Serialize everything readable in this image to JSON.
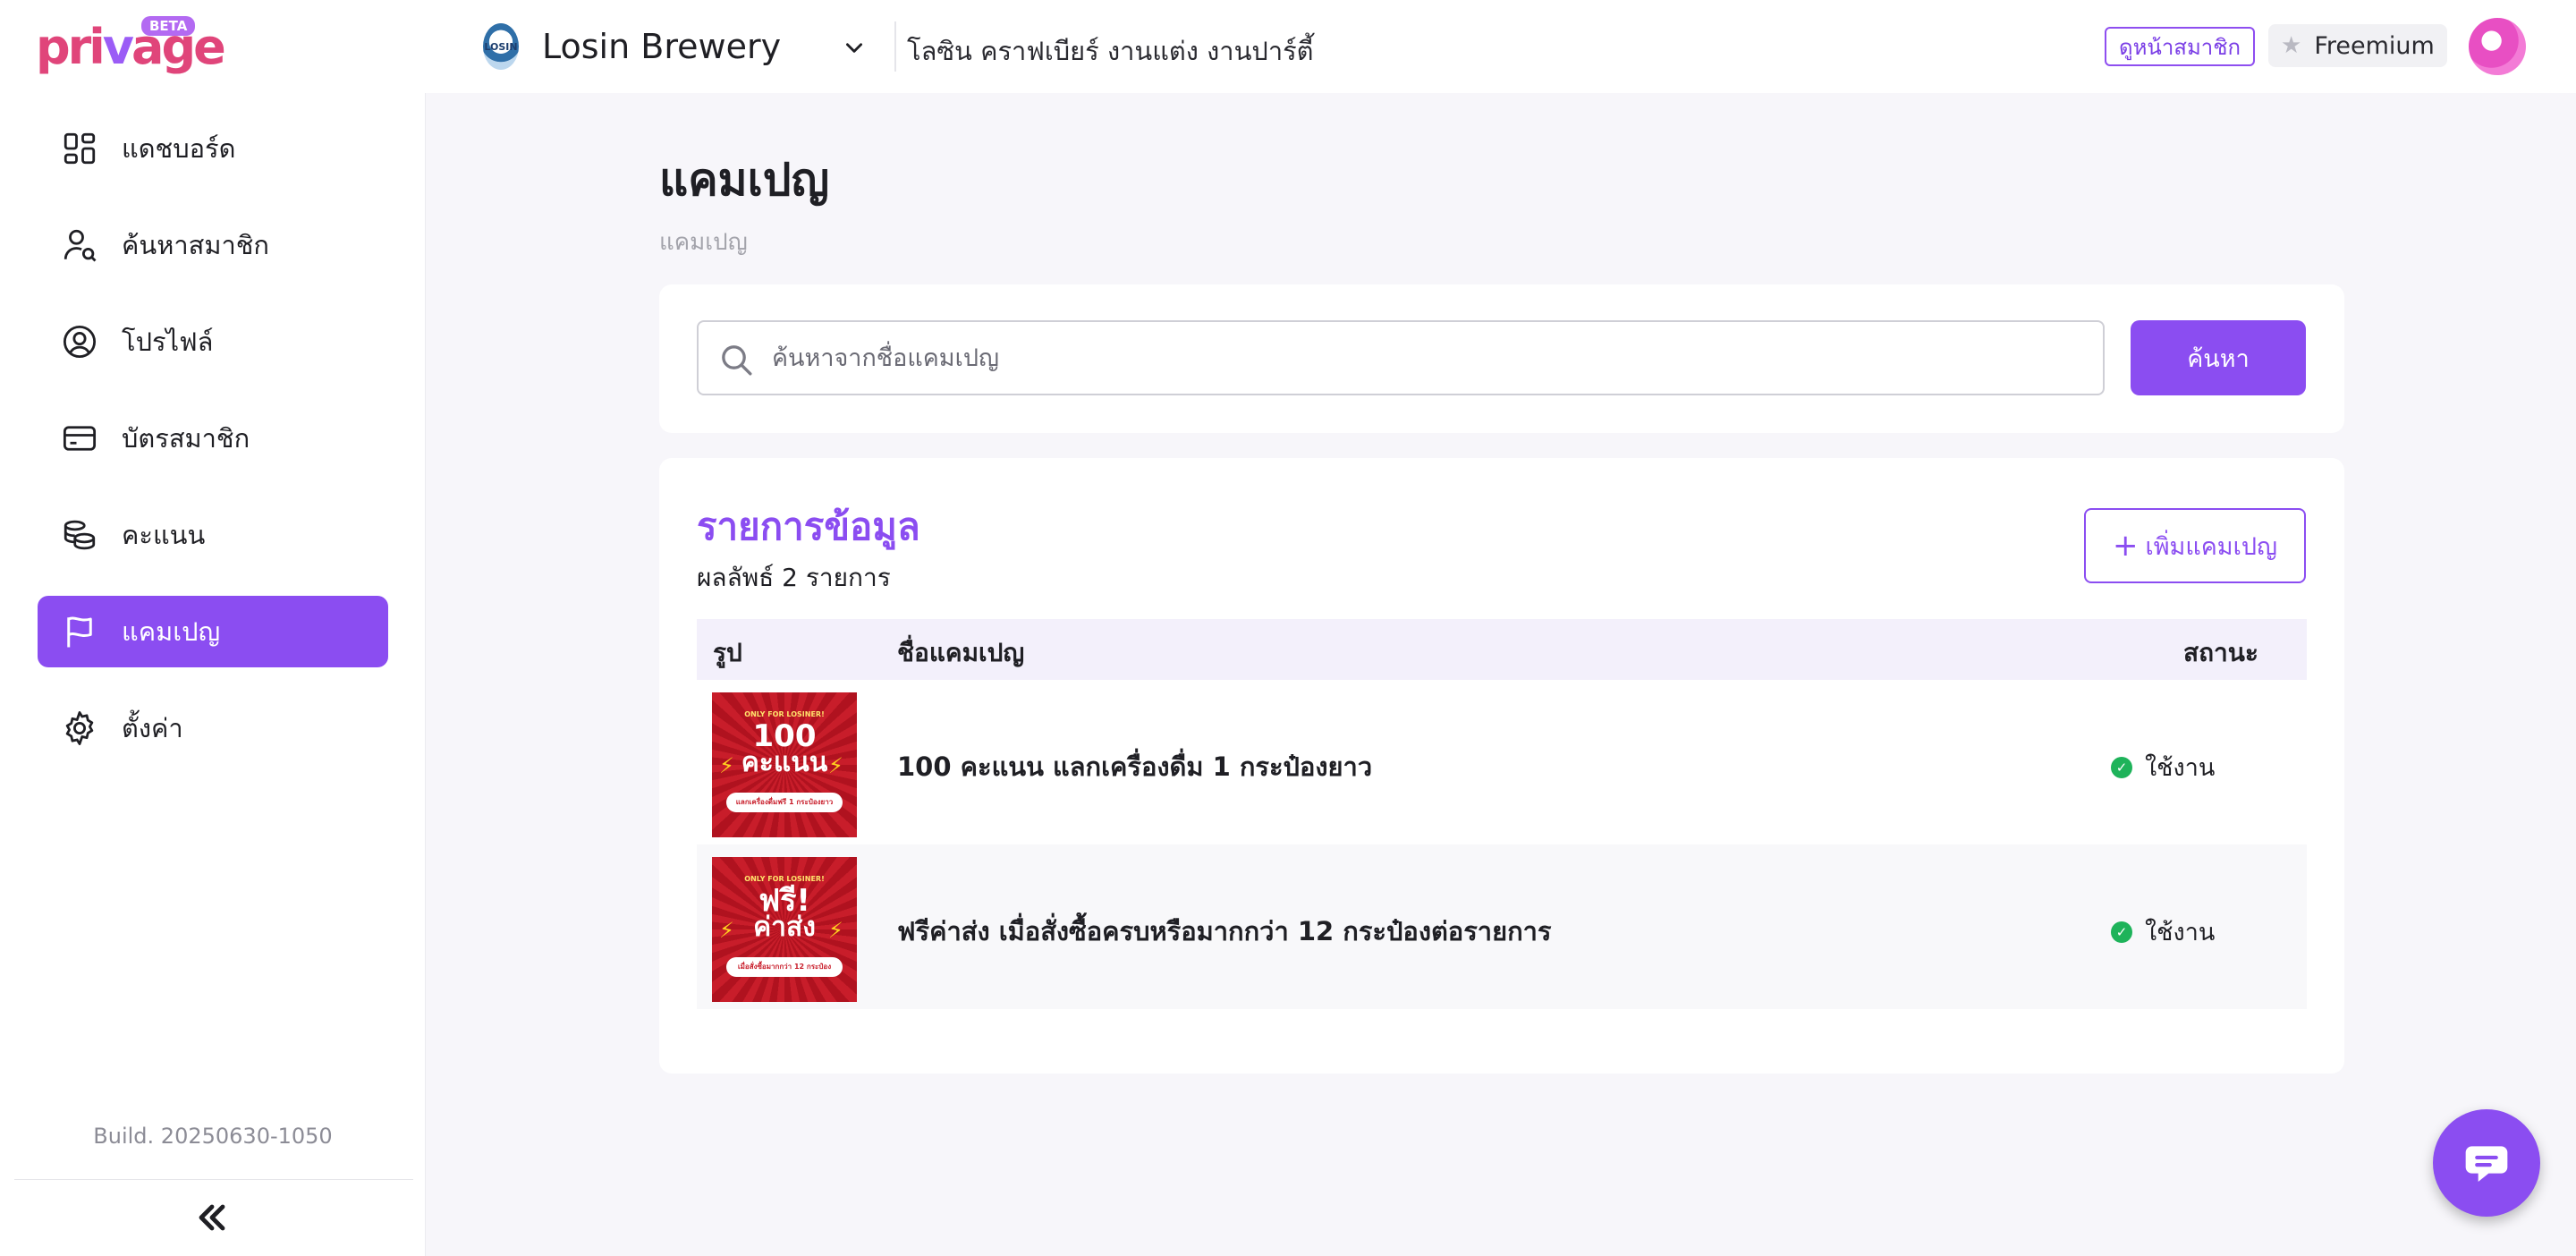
{
  "header": {
    "logo_text": "privage",
    "logo_badge": "BETA",
    "brand_logo_text": "LOSIN",
    "brand_name": "Losin Brewery",
    "brand_description": "โลซิน คราฟเบียร์ งานแต่ง งานปาร์ตี้",
    "member_page_link": "ดูหน้าสมาชิก",
    "plan_name": "Freemium"
  },
  "sidebar": {
    "items": [
      {
        "label": "แดชบอร์ด",
        "icon": "dashboard-icon",
        "active": false
      },
      {
        "label": "ค้นหาสมาชิก",
        "icon": "member-search-icon",
        "active": false
      },
      {
        "label": "โปรไฟล์",
        "icon": "profile-icon",
        "active": false
      },
      {
        "label": "บัตรสมาชิก",
        "icon": "member-card-icon",
        "active": false
      },
      {
        "label": "คะแนน",
        "icon": "points-coins-icon",
        "active": false
      },
      {
        "label": "แคมเปญ",
        "icon": "flag-icon",
        "active": true
      },
      {
        "label": "ตั้งค่า",
        "icon": "gear-icon",
        "active": false
      }
    ],
    "build": "Build. 20250630-1050",
    "collapse_icon": "double-chevron-left-icon"
  },
  "main": {
    "title": "แคมเปญ",
    "breadcrumb": "แคมเปญ",
    "search": {
      "placeholder": "ค้นหาจากชื่อแคมเปญ",
      "value": "",
      "button_label": "ค้นหา"
    },
    "list": {
      "title": "รายการข้อมูล",
      "result_count": "ผลลัพธ์ 2 รายการ",
      "add_button_label": "เพิ่มแคมเปญ",
      "columns": [
        "รูป",
        "ชื่อแคมเปญ",
        "สถานะ"
      ],
      "rows": [
        {
          "name": "100 คะแนน แลกเครื่องดื่ม 1 กระป๋องยาว",
          "status": "ใช้งาน",
          "thumb": {
            "tag": "ONLY FOR LOSINER!",
            "line1": "100",
            "line2": "คะแนน",
            "pill": "แลกเครื่องดื่มฟรี 1 กระป๋องยาว"
          }
        },
        {
          "name": "ฟรีค่าส่ง เมื่อสั่งซื้อครบหรือมากกว่า 12 กระป๋องต่อรายการ",
          "status": "ใช้งาน",
          "thumb": {
            "tag": "ONLY FOR LOSINER!",
            "line1": "ฟรี!",
            "line2": "ค่าส่ง",
            "pill": "เมื่อสั่งซื้อมากกว่า 12 กระป๋อง"
          }
        }
      ]
    }
  },
  "colors": {
    "accent": "#8b4df1",
    "logo_pink": "#e0457a",
    "status_active": "#1eb35a",
    "background": "#f7f6fa"
  },
  "chat_icon": "chat-bubble-icon"
}
